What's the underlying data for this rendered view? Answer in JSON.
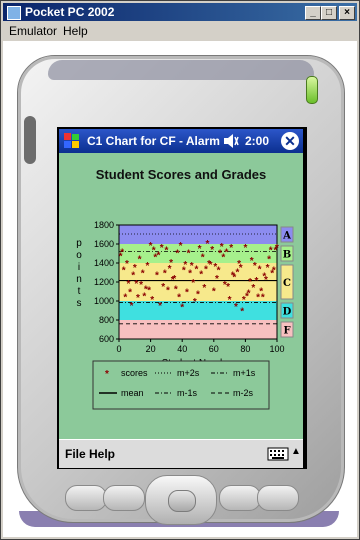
{
  "window": {
    "title": "Pocket PC 2002",
    "menu": [
      "Emulator",
      "Help"
    ],
    "controls": [
      "_",
      "□",
      "×"
    ]
  },
  "device": {
    "taskbar": {
      "title": "C1 Chart for CF - Alarm",
      "time": "2:00",
      "icons": [
        "windows-start-icon",
        "volume-icon",
        "close-icon"
      ]
    },
    "menubar": {
      "file": "File",
      "help": "Help",
      "icons": [
        "keyboard-icon",
        "up-arrow-icon"
      ]
    }
  },
  "chart_data": {
    "type": "scatter",
    "title": "Student Scores and Grades",
    "xlabel": "Student Number",
    "ylabel": "points",
    "xlim": [
      0,
      100
    ],
    "ylim": [
      600,
      1800
    ],
    "x_ticks": [
      "0",
      "20",
      "40",
      "60",
      "80",
      "100"
    ],
    "y_ticks": [
      "600",
      "800",
      "1000",
      "1200",
      "1400",
      "1600",
      "1800"
    ],
    "grade_bands": [
      {
        "grade": "A",
        "from": 1600,
        "to": 1800,
        "color": "#8c8cf0"
      },
      {
        "grade": "B",
        "from": 1400,
        "to": 1600,
        "color": "#a6f08c"
      },
      {
        "grade": "C",
        "from": 1000,
        "to": 1400,
        "color": "#f7e98c"
      },
      {
        "grade": "D",
        "from": 800,
        "to": 1000,
        "color": "#3fe0e0"
      },
      {
        "grade": "F",
        "from": 600,
        "to": 800,
        "color": "#f7c0c0"
      }
    ],
    "reference_lines": [
      {
        "name": "m+2s",
        "y": 1705,
        "style": "dotted"
      },
      {
        "name": "m+1s",
        "y": 1520,
        "style": "dashdot"
      },
      {
        "name": "mean",
        "y": 1215,
        "style": "solid"
      },
      {
        "name": "m-1s",
        "y": 985,
        "style": "dashdot"
      },
      {
        "name": "m-2s",
        "y": 760,
        "style": "dashed"
      }
    ],
    "series": [
      {
        "name": "scores",
        "color": "#8b0000",
        "x": [
          1,
          2,
          3,
          4,
          5,
          6,
          7,
          8,
          9,
          10,
          11,
          12,
          13,
          14,
          15,
          16,
          17,
          18,
          19,
          20,
          21,
          22,
          23,
          24,
          25,
          26,
          27,
          28,
          29,
          30,
          31,
          32,
          33,
          34,
          35,
          36,
          37,
          38,
          39,
          40,
          41,
          42,
          43,
          44,
          45,
          46,
          47,
          48,
          49,
          50,
          51,
          52,
          53,
          54,
          55,
          56,
          57,
          58,
          59,
          60,
          61,
          62,
          63,
          64,
          65,
          66,
          67,
          68,
          69,
          70,
          71,
          72,
          73,
          74,
          75,
          76,
          77,
          78,
          79,
          80,
          81,
          82,
          83,
          84,
          85,
          86,
          87,
          88,
          89,
          90,
          91,
          92,
          93,
          94,
          95,
          96,
          97,
          98,
          99,
          100
        ],
        "y": [
          1480,
          1520,
          1330,
          1050,
          1400,
          1190,
          1100,
          960,
          1280,
          1360,
          1190,
          1040,
          1450,
          1180,
          1300,
          1060,
          1130,
          1380,
          1120,
          1590,
          1020,
          1540,
          1470,
          1280,
          1490,
          960,
          1570,
          1160,
          1300,
          1540,
          1120,
          1350,
          1410,
          1230,
          1240,
          1130,
          1510,
          1050,
          1590,
          940,
          1330,
          1390,
          1100,
          1510,
          1300,
          1380,
          1200,
          1000,
          1340,
          1080,
          1560,
          1290,
          1470,
          1150,
          1340,
          1610,
          1400,
          1390,
          1550,
          1110,
          1370,
          1240,
          1330,
          1510,
          1580,
          1470,
          1180,
          1520,
          1160,
          1020,
          1570,
          1280,
          1260,
          950,
          1310,
          1400,
          1360,
          900,
          1020,
          1570,
          1060,
          1090,
          1210,
          1430,
          1150,
          1380,
          1220,
          1050,
          1340,
          1110,
          1050,
          1270,
          1230,
          1360,
          1450,
          1540,
          1300,
          1330,
          1540,
          1570
        ]
      }
    ],
    "legend": {
      "placement": "bottom",
      "entries": [
        "scores",
        "m+2s",
        "m+1s",
        "mean",
        "m-1s",
        "m-2s"
      ]
    }
  }
}
